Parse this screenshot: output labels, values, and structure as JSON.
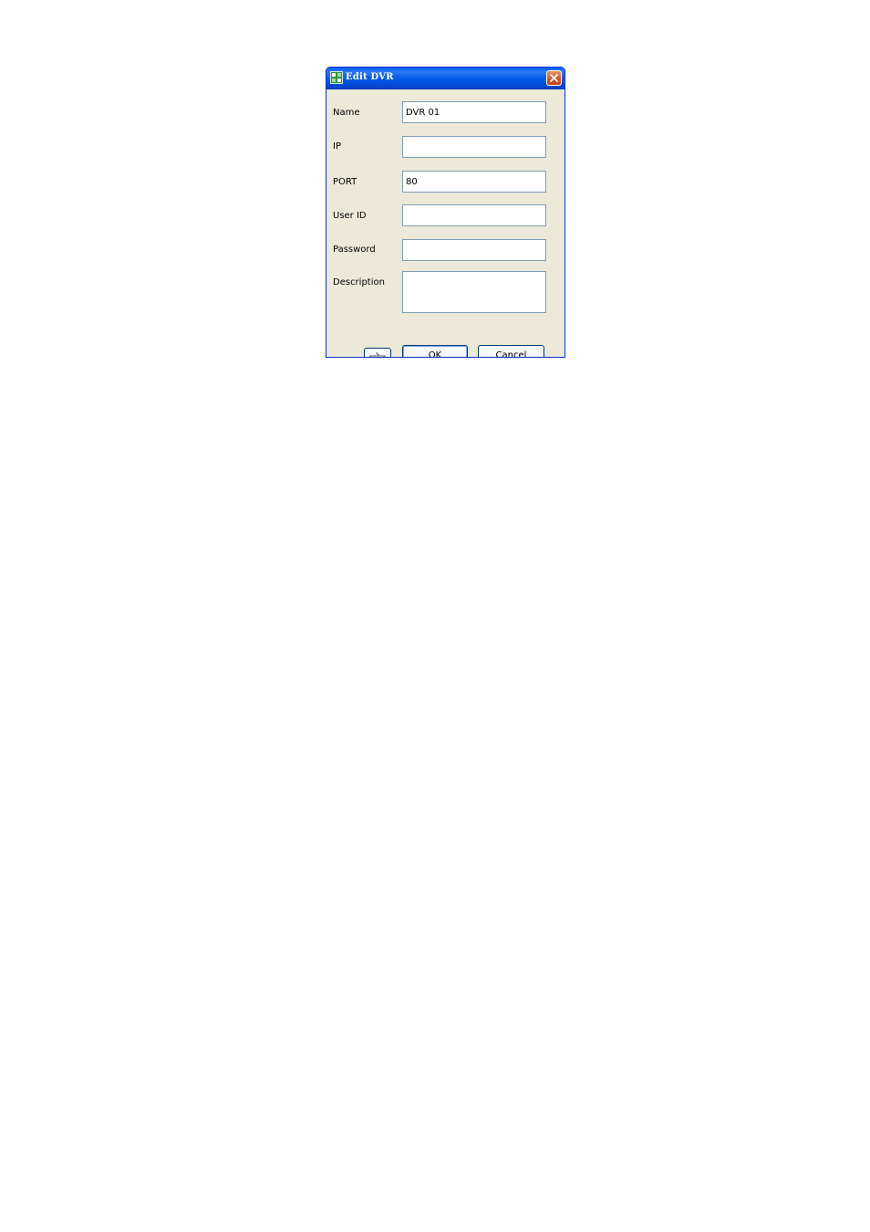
{
  "window": {
    "title": "Edit DVR",
    "close_icon": "close-icon",
    "app_icon": "app-icon"
  },
  "form": {
    "name_label": "Name",
    "name_value": "DVR 01",
    "ip_label": "IP",
    "ip_value": "",
    "port_label": "PORT",
    "port_value": "80",
    "userid_label": "User ID",
    "userid_value": "",
    "password_label": "Password",
    "password_value": "",
    "description_label": "Description",
    "description_value": ""
  },
  "buttons": {
    "keyboard_icon": "keyboard-icon",
    "ok_label": "OK",
    "cancel_label": "Cancel"
  },
  "colors": {
    "titlebar": "#0058e6",
    "dialog_bg": "#ece9d8",
    "close": "#d9532b",
    "field_border": "#7f9db9"
  }
}
